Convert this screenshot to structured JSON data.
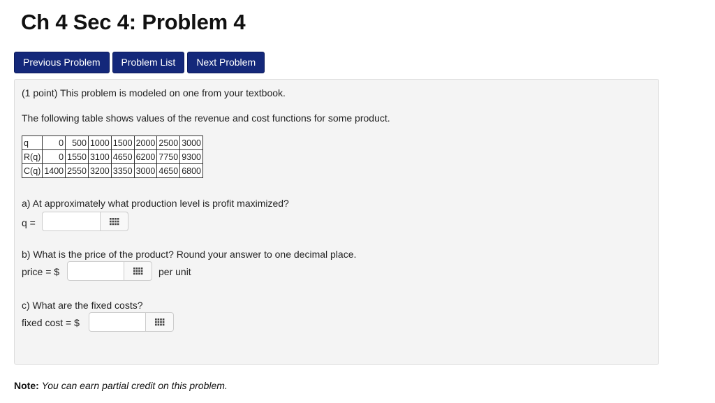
{
  "page": {
    "title": "Ch 4 Sec 4: Problem 4"
  },
  "nav": {
    "previous": "Previous Problem",
    "list": "Problem List",
    "next": "Next Problem"
  },
  "problem": {
    "intro": "(1 point) This problem is modeled on one from your textbook.",
    "description": "The following table shows values of the revenue and cost functions for some product.",
    "table": {
      "rows": [
        {
          "label": "q",
          "values": [
            "0",
            "500",
            "1000",
            "1500",
            "2000",
            "2500",
            "3000"
          ]
        },
        {
          "label": "R(q)",
          "values": [
            "0",
            "1550",
            "3100",
            "4650",
            "6200",
            "7750",
            "9300"
          ]
        },
        {
          "label": "C(q)",
          "values": [
            "1400",
            "2550",
            "3200",
            "3350",
            "3000",
            "4650",
            "6800"
          ]
        }
      ]
    },
    "part_a": {
      "question": "a) At approximately what production level is profit maximized?",
      "label": "q =",
      "value": ""
    },
    "part_b": {
      "question": "b) What is the price of the product? Round your answer to one decimal place.",
      "label": "price = $",
      "value": "",
      "unit": "per unit"
    },
    "part_c": {
      "question": "c) What are the fixed costs?",
      "label": "fixed cost = $",
      "value": ""
    }
  },
  "note": {
    "bold": "Note:",
    "text": "You can earn partial credit on this problem."
  },
  "colors": {
    "nav_button": "#14287a",
    "panel_bg": "#f4f4f4"
  },
  "icons": {
    "matrix": "matrix-grid-icon"
  }
}
